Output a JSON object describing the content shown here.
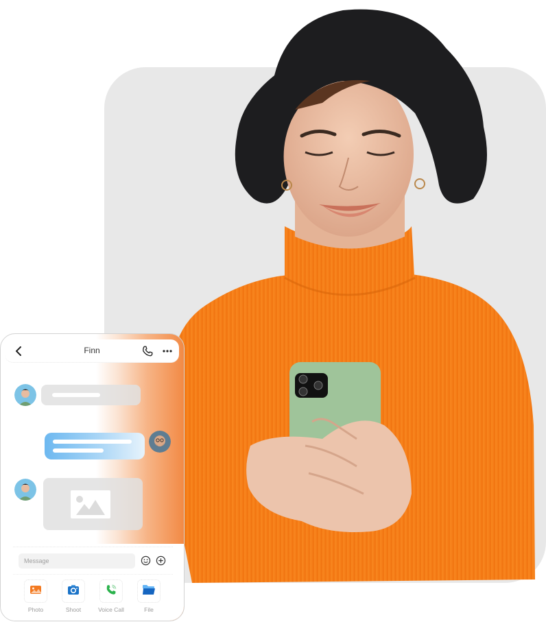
{
  "chat": {
    "title": "Finn",
    "icons": {
      "back": "chevron-left-icon",
      "call": "phone-icon",
      "more": "more-horizontal-icon",
      "emoji": "emoji-smile-icon",
      "plus": "plus-circle-icon",
      "image_placeholder": "image-icon"
    },
    "messages": [
      {
        "direction": "incoming",
        "type": "text",
        "sender": "contact"
      },
      {
        "direction": "outgoing",
        "type": "text",
        "sender": "me"
      },
      {
        "direction": "incoming",
        "type": "image",
        "sender": "contact"
      }
    ],
    "composer": {
      "placeholder": "Message"
    },
    "actions": [
      {
        "label": "Photo",
        "icon": "photo-icon",
        "color": "#f37a22"
      },
      {
        "label": "Shoot",
        "icon": "camera-icon",
        "color": "#1a73c8"
      },
      {
        "label": "Voice Call",
        "icon": "voice-call-icon",
        "color": "#2bb24c"
      },
      {
        "label": "File",
        "icon": "folder-icon",
        "color": "#1565c0"
      }
    ]
  },
  "colors": {
    "panel_bg": "#e8e8e8",
    "sweater": "#f7801c",
    "phone_case": "#9fc49a",
    "accent_gradient_end": "#f28a45",
    "outgoing_bubble": "#6db8f0"
  }
}
